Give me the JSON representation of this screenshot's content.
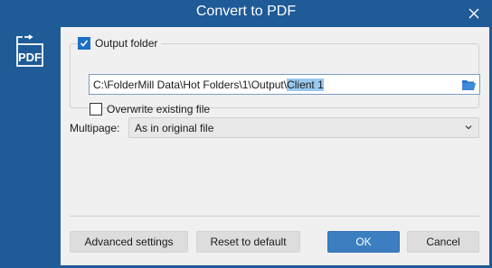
{
  "window": {
    "title": "Convert to PDF"
  },
  "output_folder": {
    "label": "Output folder",
    "checked": true,
    "path_prefix": "C:\\FolderMill Data\\Hot Folders\\1\\Output\\",
    "path_selected": "Client 1"
  },
  "overwrite": {
    "label": "Overwrite existing file",
    "checked": false
  },
  "multipage": {
    "label": "Multipage:",
    "value": "As in original file"
  },
  "buttons": {
    "advanced": "Advanced settings",
    "reset": "Reset to default",
    "ok": "OK",
    "cancel": "Cancel"
  },
  "icons": {
    "app": "pdf-convert-icon",
    "close": "close-icon",
    "folder": "folder-open-icon",
    "dropdown": "chevron-down-icon",
    "check": "check-icon"
  },
  "colors": {
    "title_bar": "#1e5b97",
    "accent": "#3b7fc1",
    "selection": "#99c9ef"
  }
}
